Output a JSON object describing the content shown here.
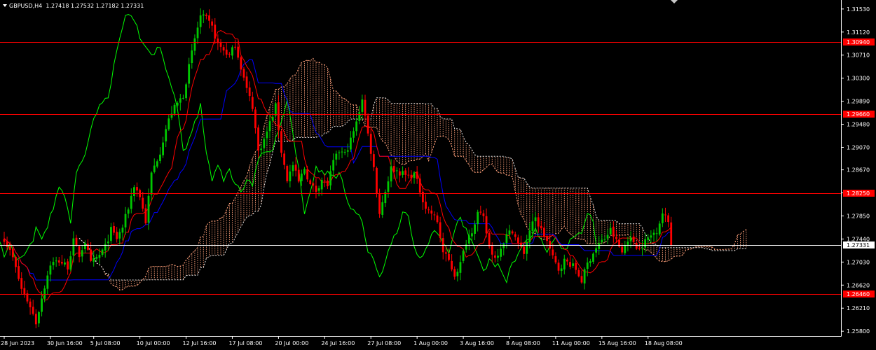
{
  "header": {
    "symbol": "GBPUSD,H4",
    "ohlc": "1.27418 1.27532 1.27182 1.27331"
  },
  "chart_data": {
    "type": "candlestick",
    "symbol": "GBPUSD",
    "timeframe": "H4",
    "ylim": [
      1.25715,
      1.3169
    ],
    "y_ticks": [
      "1.31530",
      "1.31120",
      "1.30710",
      "1.30300",
      "1.29890",
      "1.29480",
      "1.29070",
      "1.28670",
      "1.28260",
      "1.27850",
      "1.27440",
      "1.27030",
      "1.26620",
      "1.26210",
      "1.25800"
    ],
    "x_ticks": [
      {
        "label": "28 Jun 2023",
        "index": 0
      },
      {
        "label": "30 Jun 16:00",
        "index": 16
      },
      {
        "label": "5 Jul 08:00",
        "index": 31
      },
      {
        "label": "10 Jul 00:00",
        "index": 47
      },
      {
        "label": "12 Jul 16:00",
        "index": 63
      },
      {
        "label": "17 Jul 08:00",
        "index": 79
      },
      {
        "label": "20 Jul 00:00",
        "index": 95
      },
      {
        "label": "24 Jul 16:00",
        "index": 111
      },
      {
        "label": "27 Jul 08:00",
        "index": 127
      },
      {
        "label": "1 Aug 00:00",
        "index": 143
      },
      {
        "label": "3 Aug 16:00",
        "index": 159
      },
      {
        "label": "8 Aug 08:00",
        "index": 175
      },
      {
        "label": "11 Aug 00:00",
        "index": 191
      },
      {
        "label": "15 Aug 16:00",
        "index": 207
      },
      {
        "label": "18 Aug 08:00",
        "index": 223
      }
    ],
    "horizontal_levels": [
      {
        "value": 1.3094,
        "label": "1.30940",
        "color": "#ff0000"
      },
      {
        "value": 1.2966,
        "label": "1.29660",
        "color": "#ff0000"
      },
      {
        "value": 1.2825,
        "label": "1.28250",
        "color": "#ff0000"
      },
      {
        "value": 1.2646,
        "label": "1.26460",
        "color": "#ff0000"
      }
    ],
    "current_price": {
      "value": 1.27331,
      "label": "1.27331",
      "color": "#ffffff"
    },
    "path_anchors": [
      [
        0,
        1.2745
      ],
      [
        3,
        1.271
      ],
      [
        6,
        1.2655
      ],
      [
        9,
        1.2625
      ],
      [
        11,
        1.2595
      ],
      [
        13,
        1.264
      ],
      [
        16,
        1.27
      ],
      [
        19,
        1.2705
      ],
      [
        22,
        1.2695
      ],
      [
        24,
        1.274
      ],
      [
        26,
        1.2715
      ],
      [
        28,
        1.274
      ],
      [
        30,
        1.27
      ],
      [
        33,
        1.2715
      ],
      [
        35,
        1.273
      ],
      [
        37,
        1.276
      ],
      [
        39,
        1.2745
      ],
      [
        41,
        1.2765
      ],
      [
        43,
        1.28
      ],
      [
        45,
        1.284
      ],
      [
        47,
        1.282
      ],
      [
        49,
        1.2775
      ],
      [
        51,
        1.286
      ],
      [
        54,
        1.29
      ],
      [
        56,
        1.294
      ],
      [
        58,
        1.297
      ],
      [
        60,
        1.2985
      ],
      [
        62,
        1.3
      ],
      [
        64,
        1.305
      ],
      [
        66,
        1.31
      ],
      [
        68,
        1.314
      ],
      [
        70,
        1.3135
      ],
      [
        72,
        1.312
      ],
      [
        74,
        1.309
      ],
      [
        76,
        1.308
      ],
      [
        78,
        1.307
      ],
      [
        80,
        1.309
      ],
      [
        82,
        1.305
      ],
      [
        84,
        1.301
      ],
      [
        86,
        1.298
      ],
      [
        88,
        1.29
      ],
      [
        90,
        1.292
      ],
      [
        92,
        1.295
      ],
      [
        94,
        1.298
      ],
      [
        96,
        1.29
      ],
      [
        98,
        1.285
      ],
      [
        100,
        1.2875
      ],
      [
        102,
        1.2845
      ],
      [
        104,
        1.287
      ],
      [
        106,
        1.284
      ],
      [
        108,
        1.283
      ],
      [
        110,
        1.285
      ],
      [
        112,
        1.284
      ],
      [
        114,
        1.288
      ],
      [
        116,
        1.29
      ],
      [
        118,
        1.2895
      ],
      [
        120,
        1.292
      ],
      [
        122,
        1.295
      ],
      [
        124,
        1.2995
      ],
      [
        126,
        1.293
      ],
      [
        128,
        1.287
      ],
      [
        130,
        1.279
      ],
      [
        132,
        1.283
      ],
      [
        134,
        1.287
      ],
      [
        136,
        1.2865
      ],
      [
        138,
        1.286
      ],
      [
        140,
        1.2855
      ],
      [
        142,
        1.286
      ],
      [
        144,
        1.283
      ],
      [
        146,
        1.28
      ],
      [
        148,
        1.279
      ],
      [
        150,
        1.2775
      ],
      [
        152,
        1.272
      ],
      [
        154,
        1.2705
      ],
      [
        156,
        1.268
      ],
      [
        158,
        1.27
      ],
      [
        160,
        1.274
      ],
      [
        162,
        1.276
      ],
      [
        164,
        1.279
      ],
      [
        166,
        1.278
      ],
      [
        168,
        1.273
      ],
      [
        170,
        1.271
      ],
      [
        172,
        1.273
      ],
      [
        174,
        1.275
      ],
      [
        176,
        1.276
      ],
      [
        178,
        1.2735
      ],
      [
        180,
        1.272
      ],
      [
        182,
        1.276
      ],
      [
        184,
        1.278
      ],
      [
        186,
        1.276
      ],
      [
        188,
        1.274
      ],
      [
        190,
        1.271
      ],
      [
        192,
        1.269
      ],
      [
        194,
        1.2705
      ],
      [
        196,
        1.27
      ],
      [
        198,
        1.269
      ],
      [
        200,
        1.267
      ],
      [
        202,
        1.27
      ],
      [
        204,
        1.272
      ],
      [
        206,
        1.2735
      ],
      [
        208,
        1.2745
      ],
      [
        210,
        1.276
      ],
      [
        212,
        1.274
      ],
      [
        214,
        1.272
      ],
      [
        216,
        1.2745
      ],
      [
        218,
        1.274
      ],
      [
        220,
        1.2725
      ],
      [
        222,
        1.274
      ],
      [
        224,
        1.275
      ],
      [
        226,
        1.276
      ],
      [
        228,
        1.279
      ],
      [
        230,
        1.2775
      ],
      [
        231,
        1.2733
      ]
    ],
    "candle_count": 232,
    "up_color": "#00c800",
    "down_color": "#ff0000",
    "indicators": {
      "name": "Ichimoku Kinko Hyo",
      "tenkan_color": "#ff0000",
      "kijun_color": "#0000ff",
      "chikou_color": "#00ff00",
      "cloud_color": "#ffa07a"
    },
    "colors": {
      "background": "#000000",
      "foreground": "#ffffff",
      "grid": "none"
    }
  }
}
